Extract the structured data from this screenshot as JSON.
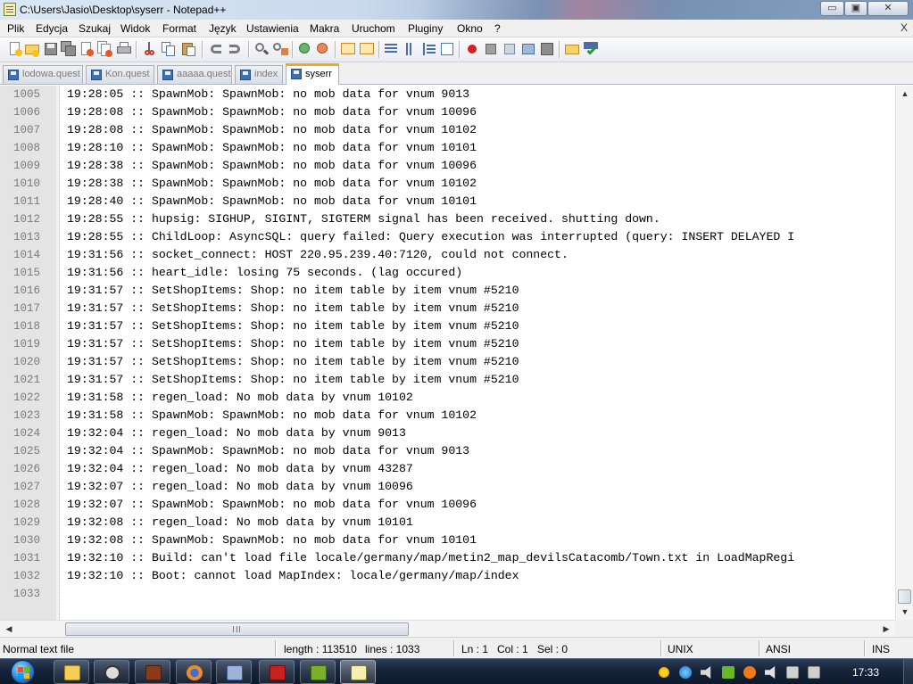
{
  "window": {
    "title": "C:\\Users\\Jasio\\Desktop\\syserr - Notepad++",
    "minimize_glyph": "▭",
    "maximize_glyph": "▣",
    "close_glyph": "✕"
  },
  "menu": {
    "items": [
      "Plik",
      "Edycja",
      "Szukaj",
      "Widok",
      "Format",
      "Język",
      "Ustawienia",
      "Makra",
      "Uruchom",
      "Pluginy",
      "Okno",
      "?"
    ],
    "close_label": "X"
  },
  "toolbar": {
    "icons": [
      "new-file-icon",
      "open-file-icon",
      "save-icon",
      "save-all-icon",
      "close-icon",
      "close-all-icon",
      "print-icon",
      "cut-icon",
      "copy-icon",
      "paste-icon",
      "undo-icon",
      "redo-icon",
      "find-icon",
      "replace-icon",
      "zoom-in-icon",
      "zoom-out-icon",
      "sync-vertical-icon",
      "sync-horizontal-icon",
      "word-wrap-icon",
      "show-all-chars-icon",
      "indent-guide-icon",
      "user-lang-icon",
      "macro-record-icon",
      "macro-stop-icon",
      "macro-play-icon",
      "macro-run-multiple-icon",
      "macro-save-icon",
      "plugin-icon",
      "spellcheck-icon"
    ]
  },
  "tabs": [
    {
      "label": "lodowa.quest",
      "active": false
    },
    {
      "label": "Kon.quest",
      "active": false
    },
    {
      "label": "aaaaa.quest",
      "active": false
    },
    {
      "label": "index",
      "active": false
    },
    {
      "label": "syserr",
      "active": true
    }
  ],
  "editor": {
    "lines": [
      {
        "num": "1005",
        "text": "19:28:05 :: SpawnMob: SpawnMob: no mob data for vnum 9013"
      },
      {
        "num": "1006",
        "text": "19:28:08 :: SpawnMob: SpawnMob: no mob data for vnum 10096"
      },
      {
        "num": "1007",
        "text": "19:28:08 :: SpawnMob: SpawnMob: no mob data for vnum 10102"
      },
      {
        "num": "1008",
        "text": "19:28:10 :: SpawnMob: SpawnMob: no mob data for vnum 10101"
      },
      {
        "num": "1009",
        "text": "19:28:38 :: SpawnMob: SpawnMob: no mob data for vnum 10096"
      },
      {
        "num": "1010",
        "text": "19:28:38 :: SpawnMob: SpawnMob: no mob data for vnum 10102"
      },
      {
        "num": "1011",
        "text": "19:28:40 :: SpawnMob: SpawnMob: no mob data for vnum 10101"
      },
      {
        "num": "1012",
        "text": "19:28:55 :: hupsig: SIGHUP, SIGINT, SIGTERM signal has been received. shutting down."
      },
      {
        "num": "1013",
        "text": "19:28:55 :: ChildLoop: AsyncSQL: query failed: Query execution was interrupted (query: INSERT DELAYED I"
      },
      {
        "num": "1014",
        "text": "19:31:56 :: socket_connect: HOST 220.95.239.40:7120, could not connect."
      },
      {
        "num": "1015",
        "text": "19:31:56 :: heart_idle: losing 75 seconds. (lag occured)"
      },
      {
        "num": "1016",
        "text": "19:31:57 :: SetShopItems: Shop: no item table by item vnum #5210"
      },
      {
        "num": "1017",
        "text": "19:31:57 :: SetShopItems: Shop: no item table by item vnum #5210"
      },
      {
        "num": "1018",
        "text": "19:31:57 :: SetShopItems: Shop: no item table by item vnum #5210"
      },
      {
        "num": "1019",
        "text": "19:31:57 :: SetShopItems: Shop: no item table by item vnum #5210"
      },
      {
        "num": "1020",
        "text": "19:31:57 :: SetShopItems: Shop: no item table by item vnum #5210"
      },
      {
        "num": "1021",
        "text": "19:31:57 :: SetShopItems: Shop: no item table by item vnum #5210"
      },
      {
        "num": "1022",
        "text": "19:31:58 :: regen_load: No mob data by vnum 10102"
      },
      {
        "num": "1023",
        "text": "19:31:58 :: SpawnMob: SpawnMob: no mob data for vnum 10102"
      },
      {
        "num": "1024",
        "text": "19:32:04 :: regen_load: No mob data by vnum 9013"
      },
      {
        "num": "1025",
        "text": "19:32:04 :: SpawnMob: SpawnMob: no mob data for vnum 9013"
      },
      {
        "num": "1026",
        "text": "19:32:04 :: regen_load: No mob data by vnum 43287"
      },
      {
        "num": "1027",
        "text": "19:32:07 :: regen_load: No mob data by vnum 10096"
      },
      {
        "num": "1028",
        "text": "19:32:07 :: SpawnMob: SpawnMob: no mob data for vnum 10096"
      },
      {
        "num": "1029",
        "text": "19:32:08 :: regen_load: No mob data by vnum 10101"
      },
      {
        "num": "1030",
        "text": "19:32:08 :: SpawnMob: SpawnMob: no mob data for vnum 10101"
      },
      {
        "num": "1031",
        "text": "19:32:10 :: Build: can't load file locale/germany/map/metin2_map_devilsCatacomb/Town.txt in LoadMapRegi"
      },
      {
        "num": "1032",
        "text": "19:32:10 :: Boot: cannot load MapIndex: locale/germany/map/index"
      },
      {
        "num": "1033",
        "text": ""
      }
    ]
  },
  "scrollbars": {
    "up": "▲",
    "down": "▼",
    "left": "◀",
    "right": "▶"
  },
  "status": {
    "file_type": "Normal text file",
    "length": "length : 113510",
    "lines": "lines : 1033",
    "ln": "Ln : 1",
    "col": "Col : 1",
    "sel": "Sel : 0",
    "eol": "UNIX",
    "encoding": "ANSI",
    "mode": "INS"
  },
  "taskbar": {
    "pinned": [
      "explorer-icon",
      "game-client-icon",
      "metin-icon",
      "firefox-icon",
      "virtualbox-icon",
      "filezilla-icon",
      "d-app-icon",
      "notepadpp-icon"
    ],
    "tray": [
      "sun-icon",
      "network-globe-icon",
      "speaker-icon",
      "nvidia-icon",
      "avast-icon",
      "volume-icon",
      "flag-icon",
      "network-icon"
    ],
    "clock": "17:33"
  }
}
